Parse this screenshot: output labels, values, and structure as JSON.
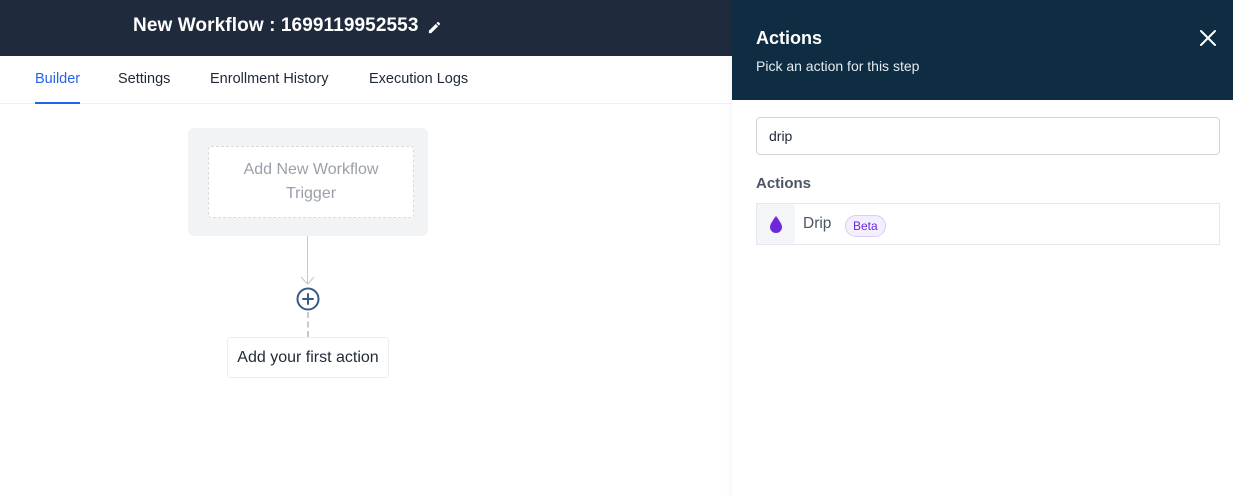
{
  "header": {
    "title": "New Workflow : 1699119952553",
    "edit_icon": "pencil-icon"
  },
  "tabs": [
    {
      "label": "Builder",
      "active": true
    },
    {
      "label": "Settings",
      "active": false
    },
    {
      "label": "Enrollment History",
      "active": false
    },
    {
      "label": "Execution Logs",
      "active": false
    }
  ],
  "canvas": {
    "trigger_label": "Add New Workflow Trigger",
    "add_icon": "plus-circle-icon",
    "first_action_label": "Add your first action"
  },
  "panel": {
    "title": "Actions",
    "subtitle": "Pick an action for this step",
    "close_icon": "close-icon",
    "search_value": "drip",
    "section_label": "Actions",
    "actions": [
      {
        "label": "Drip",
        "badge": "Beta",
        "icon": "drop-icon"
      }
    ]
  },
  "colors": {
    "header_bg": "#1f2a3c",
    "panel_header_bg": "#0e2d42",
    "accent": "#2563eb",
    "drip_icon": "#6d28d9"
  }
}
